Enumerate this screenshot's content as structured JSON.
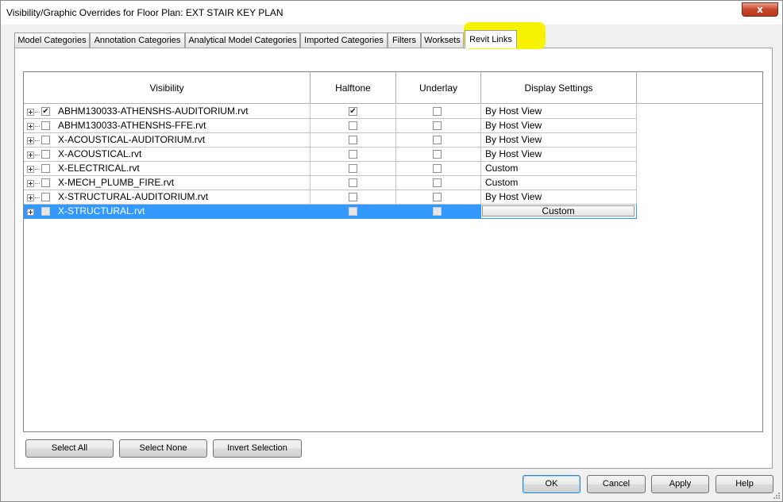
{
  "window": {
    "title": "Visibility/Graphic Overrides for Floor Plan: EXT STAIR KEY PLAN",
    "close_glyph": "x"
  },
  "tabs": [
    {
      "label": "Model Categories"
    },
    {
      "label": "Annotation Categories"
    },
    {
      "label": "Analytical Model Categories"
    },
    {
      "label": "Imported Categories"
    },
    {
      "label": "Filters"
    },
    {
      "label": "Worksets"
    },
    {
      "label": "Revit Links",
      "active": true
    }
  ],
  "table": {
    "headers": {
      "visibility": "Visibility",
      "halftone": "Halftone",
      "underlay": "Underlay",
      "display": "Display Settings"
    },
    "rows": [
      {
        "name": "ABHM130033-ATHENSHS-AUDITORIUM.rvt",
        "visible": true,
        "halftone": true,
        "underlay": false,
        "display": "By Host View"
      },
      {
        "name": "ABHM130033-ATHENSHS-FFE.rvt",
        "visible": false,
        "halftone": false,
        "underlay": false,
        "display": "By Host View"
      },
      {
        "name": "X-ACOUSTICAL-AUDITORIUM.rvt",
        "visible": false,
        "halftone": false,
        "underlay": false,
        "display": "By Host View"
      },
      {
        "name": "X-ACOUSTICAL.rvt",
        "visible": false,
        "halftone": false,
        "underlay": false,
        "display": "By Host View"
      },
      {
        "name": "X-ELECTRICAL.rvt",
        "visible": false,
        "halftone": false,
        "underlay": false,
        "display": "Custom"
      },
      {
        "name": "X-MECH_PLUMB_FIRE.rvt",
        "visible": false,
        "halftone": false,
        "underlay": false,
        "display": "Custom"
      },
      {
        "name": "X-STRUCTURAL-AUDITORIUM.rvt",
        "visible": false,
        "halftone": false,
        "underlay": false,
        "display": "By Host View"
      },
      {
        "name": "X-STRUCTURAL.rvt",
        "visible": false,
        "halftone": false,
        "underlay": false,
        "display": "Custom",
        "selected": true
      }
    ]
  },
  "selection_buttons": {
    "select_all": "Select All",
    "select_none": "Select None",
    "invert": "Invert Selection"
  },
  "dialog_buttons": {
    "ok": "OK",
    "cancel": "Cancel",
    "apply": "Apply",
    "help": "Help"
  },
  "colors": {
    "highlight": "#f7f300",
    "selection": "#3399ff"
  }
}
